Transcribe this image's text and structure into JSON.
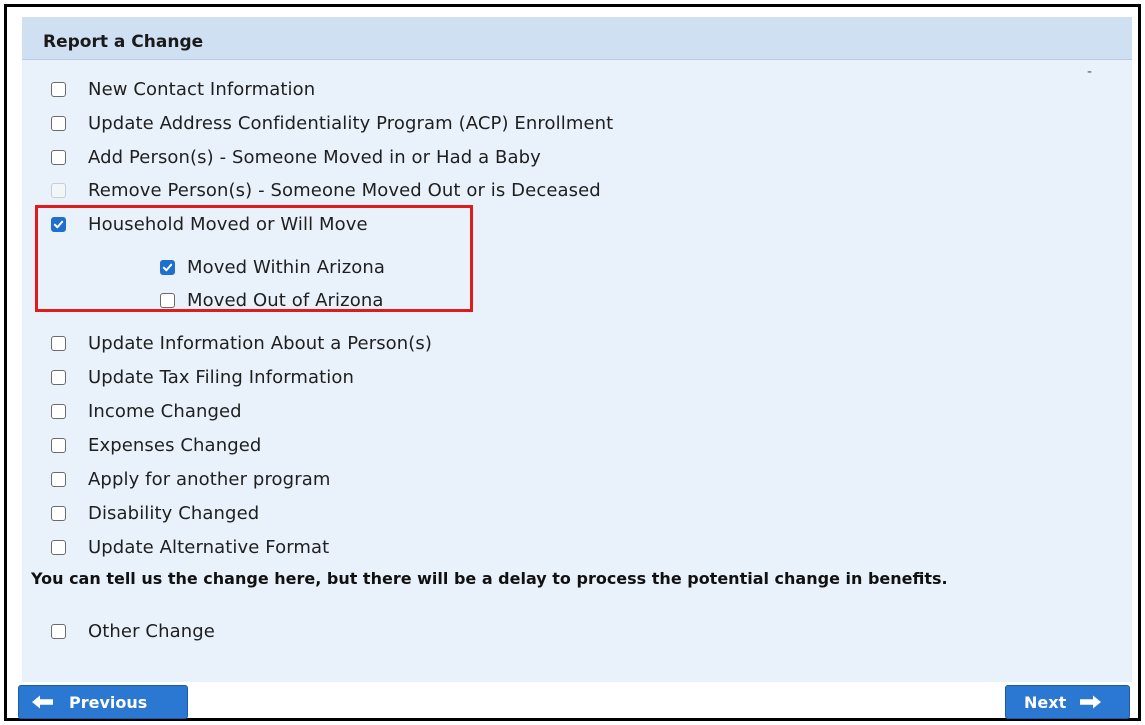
{
  "panel": {
    "title": "Report a Change",
    "dash": "-"
  },
  "options": [
    {
      "label": "New Contact Information",
      "checked": false,
      "disabled": false
    },
    {
      "label": "Update Address Confidentiality Program (ACP) Enrollment",
      "checked": false,
      "disabled": false
    },
    {
      "label": "Add Person(s) - Someone Moved in or Had a Baby",
      "checked": false,
      "disabled": false
    },
    {
      "label": "Remove Person(s) - Someone Moved Out or is Deceased",
      "checked": false,
      "disabled": true
    },
    {
      "label": "Household Moved or Will Move",
      "checked": true,
      "disabled": false
    },
    {
      "label": "Update Information About a Person(s)",
      "checked": false,
      "disabled": false
    },
    {
      "label": "Update Tax Filing Information",
      "checked": false,
      "disabled": false
    },
    {
      "label": "Income Changed",
      "checked": false,
      "disabled": false
    },
    {
      "label": "Expenses Changed",
      "checked": false,
      "disabled": false
    },
    {
      "label": "Apply for another program",
      "checked": false,
      "disabled": false
    },
    {
      "label": "Disability Changed",
      "checked": false,
      "disabled": false
    },
    {
      "label": "Update Alternative Format",
      "checked": false,
      "disabled": false
    }
  ],
  "sub_options": [
    {
      "label": "Moved Within Arizona",
      "checked": true
    },
    {
      "label": "Moved Out of Arizona",
      "checked": false
    }
  ],
  "note": "You can tell us the change here, but there will be a delay to process the potential change in benefits.",
  "other": {
    "label": "Other Change",
    "checked": false
  },
  "buttons": {
    "previous": "Previous",
    "next": "Next"
  },
  "colors": {
    "accent": "#2b78d3",
    "highlight": "#e01b1b",
    "panel_bg": "#e9f1fa",
    "header_bg": "#cfe0f3"
  }
}
